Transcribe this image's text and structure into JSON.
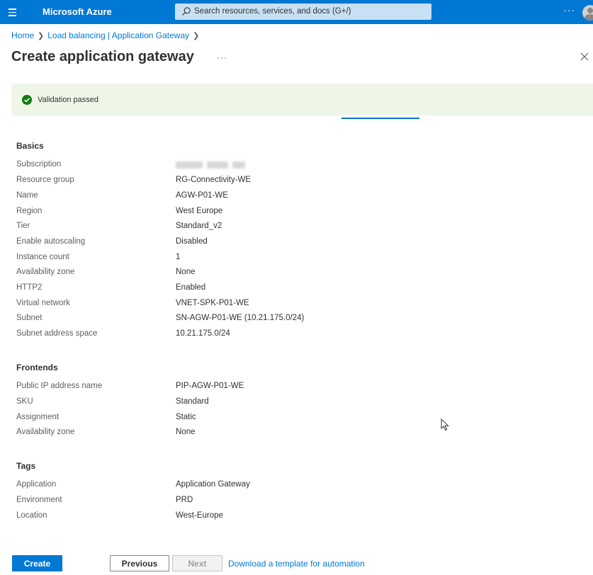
{
  "app": {
    "brand": "Microsoft Azure",
    "search_placeholder": "Search resources, services, and docs (G+/)",
    "more": "···"
  },
  "breadcrumb": {
    "items": [
      "Home",
      "Load balancing | Application Gateway"
    ]
  },
  "page": {
    "title": "Create application gateway",
    "more": "···"
  },
  "validation": {
    "message": "Validation passed",
    "status_color": "#107c10"
  },
  "sections": [
    {
      "title": "Basics",
      "rows": [
        {
          "label": "Subscription",
          "value": ""
        },
        {
          "label": "Resource group",
          "value": "RG-Connectivity-WE"
        },
        {
          "label": "Name",
          "value": "AGW-P01-WE"
        },
        {
          "label": "Region",
          "value": "West Europe"
        },
        {
          "label": "Tier",
          "value": "Standard_v2"
        },
        {
          "label": "Enable autoscaling",
          "value": "Disabled"
        },
        {
          "label": "Instance count",
          "value": "1"
        },
        {
          "label": "Availability zone",
          "value": "None"
        },
        {
          "label": "HTTP2",
          "value": "Enabled"
        },
        {
          "label": "Virtual network",
          "value": "VNET-SPK-P01-WE"
        },
        {
          "label": "Subnet",
          "value": "SN-AGW-P01-WE (10.21.175.0/24)"
        },
        {
          "label": "Subnet address space",
          "value": "10.21.175.0/24"
        }
      ]
    },
    {
      "title": "Frontends",
      "rows": [
        {
          "label": "Public IP address name",
          "value": "PIP-AGW-P01-WE"
        },
        {
          "label": "SKU",
          "value": "Standard"
        },
        {
          "label": "Assignment",
          "value": "Static"
        },
        {
          "label": "Availability zone",
          "value": "None"
        }
      ]
    },
    {
      "title": "Tags",
      "rows": [
        {
          "label": "Application",
          "value": "Application Gateway"
        },
        {
          "label": "Environment",
          "value": "PRD"
        },
        {
          "label": "Location",
          "value": "West-Europe"
        }
      ]
    }
  ],
  "footer": {
    "create_label": "Create",
    "previous_label": "Previous",
    "next_label": "Next",
    "download_label": "Download a template for automation"
  },
  "colors": {
    "accent": "#0078d4",
    "banner_bg": "#eff6e8"
  }
}
